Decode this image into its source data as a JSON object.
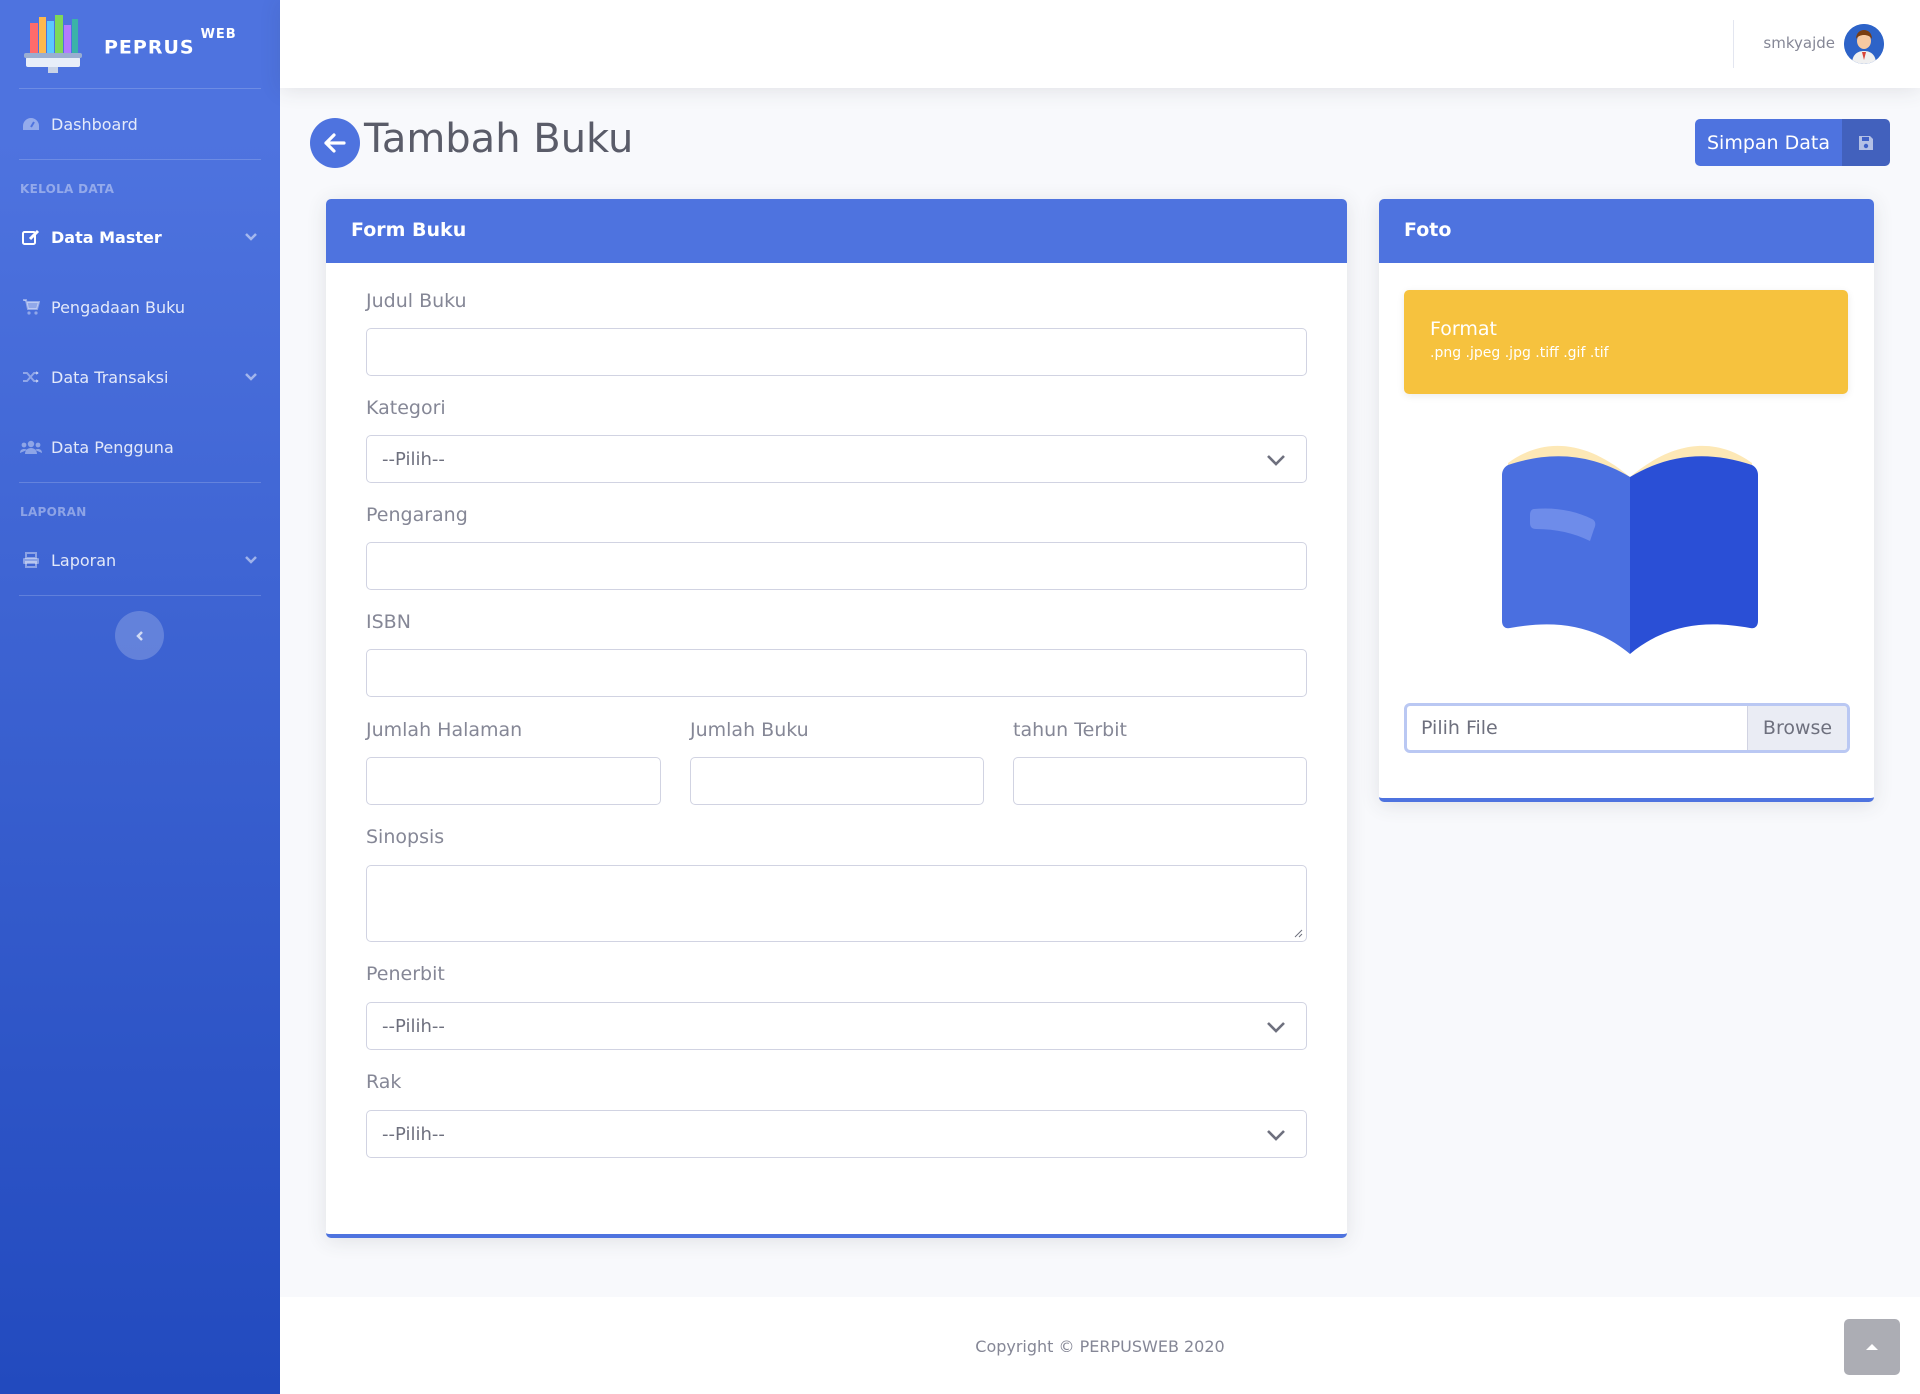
{
  "brand": {
    "name": "PEPRUS",
    "suffix": "WEB"
  },
  "sidebar": {
    "dashboard": "Dashboard",
    "heading_kelola": "KELOLA DATA",
    "data_master": "Data Master",
    "pengadaan": "Pengadaan Buku",
    "transaksi": "Data Transaksi",
    "pengguna": "Data Pengguna",
    "heading_laporan": "LAPORAN",
    "laporan": "Laporan"
  },
  "topbar": {
    "username": "smkyajde"
  },
  "page": {
    "title": "Tambah Buku",
    "save_label": "Simpan Data"
  },
  "form": {
    "header": "Form Buku",
    "judul_label": "Judul Buku",
    "judul_value": "",
    "kategori_label": "Kategori",
    "kategori_value": "--Pilih--",
    "pengarang_label": "Pengarang",
    "pengarang_value": "",
    "isbn_label": "ISBN",
    "isbn_value": "",
    "halaman_label": "Jumlah Halaman",
    "halaman_value": "",
    "jumlah_label": "Jumlah Buku",
    "jumlah_value": "",
    "tahun_label": "tahun Terbit",
    "tahun_value": "",
    "sinopsis_label": "Sinopsis",
    "sinopsis_value": "",
    "penerbit_label": "Penerbit",
    "penerbit_value": "--Pilih--",
    "rak_label": "Rak",
    "rak_value": "--Pilih--"
  },
  "photo": {
    "header": "Foto",
    "format_title": "Format",
    "format_text": ".png .jpeg .jpg .tiff .gif .tif",
    "file_placeholder": "Pilih File",
    "browse_label": "Browse"
  },
  "footer": {
    "copyright": "Copyright © PERPUSWEB 2020"
  },
  "colors": {
    "primary": "#4e73df",
    "warning": "#f6c23e",
    "sidebar_dark": "#224abe"
  },
  "icons": [
    "tachometer-icon",
    "edit-icon",
    "cart-icon",
    "random-icon",
    "users-icon",
    "print-icon",
    "chevron-down-icon",
    "arrow-left-icon",
    "save-icon",
    "chevron-up-icon",
    "chevron-left-icon"
  ]
}
